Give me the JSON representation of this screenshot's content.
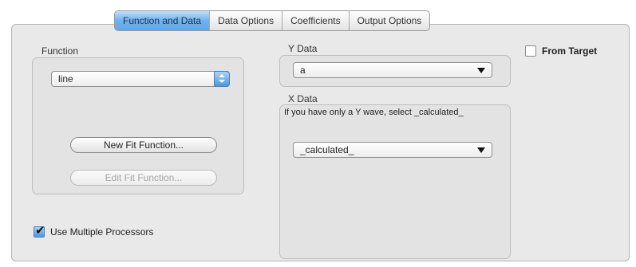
{
  "tabs": [
    {
      "label": "Function and Data",
      "active": true
    },
    {
      "label": "Data Options",
      "active": false
    },
    {
      "label": "Coefficients",
      "active": false
    },
    {
      "label": "Output Options",
      "active": false
    }
  ],
  "function_section": {
    "label": "Function",
    "function_select": {
      "value": "line"
    },
    "new_fit_button": "New Fit Function...",
    "edit_fit_button": "Edit Fit Function..."
  },
  "y_data": {
    "label": "Y Data",
    "select_value": "a"
  },
  "x_data": {
    "label": "X Data",
    "hint": "If you have only a Y wave, select _calculated_",
    "select_value": "_calculated_"
  },
  "from_target": {
    "label": "From Target",
    "checked": false
  },
  "multiple_processors": {
    "label": "Use Multiple Processors",
    "checked": true
  },
  "colors": {
    "accent": "#62a7e8",
    "panel_bg": "#e9e9e9"
  }
}
